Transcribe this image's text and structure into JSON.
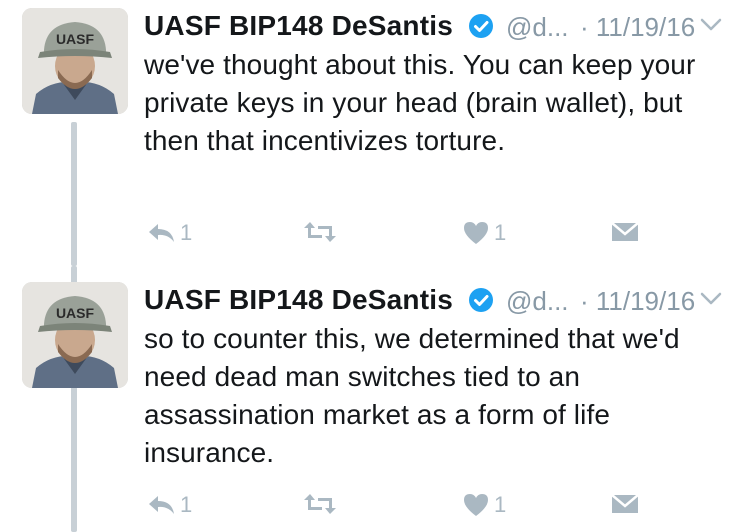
{
  "tweets": [
    {
      "author": "UASF BIP148 DeSantis",
      "handle": "@d...",
      "date": "· 11/19/16",
      "avatar_cap_text": "UASF",
      "text": "we've thought about this. You can keep your private keys in your head (brain wallet), but then that incentivizes torture.",
      "reply_count": "1",
      "retweet_count": "",
      "like_count": "1"
    },
    {
      "author": "UASF BIP148 DeSantis",
      "handle": "@d...",
      "date": "· 11/19/16",
      "avatar_cap_text": "UASF",
      "text": "so to counter this, we determined that we'd need dead man switches tied to an assassination market as a form of life insurance.",
      "reply_count": "1",
      "retweet_count": "",
      "like_count": "1"
    }
  ],
  "icons": {
    "verified": "verified-badge-icon",
    "menu": "chevron-down-icon",
    "reply": "reply-icon",
    "retweet": "retweet-icon",
    "like": "heart-icon",
    "message": "direct-message-icon"
  },
  "colors": {
    "text": "#14171a",
    "muted": "#8899a6",
    "icon": "#aab8c2",
    "verified": "#1da1f2",
    "thread_line": "#c8d0d6"
  }
}
